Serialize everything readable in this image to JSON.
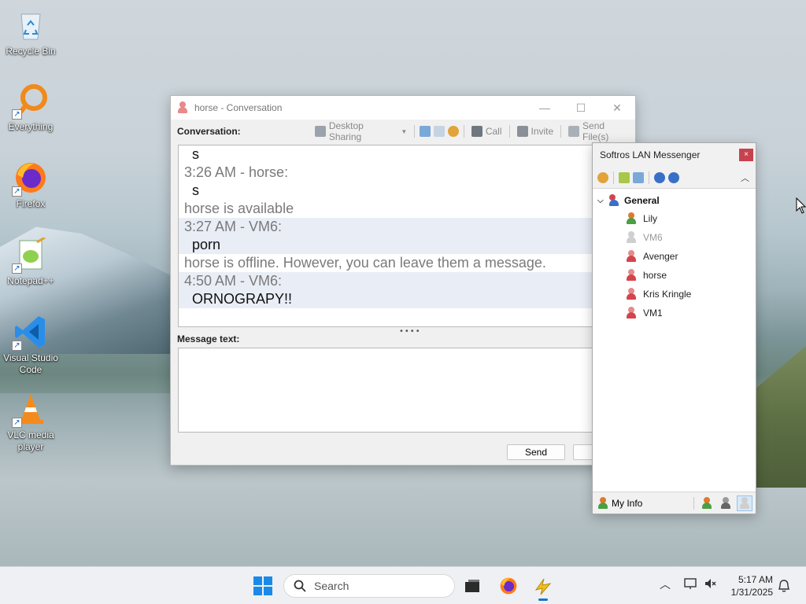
{
  "desktop": {
    "icons": [
      {
        "label": "Recycle Bin"
      },
      {
        "label": "Everything"
      },
      {
        "label": "Firefox"
      },
      {
        "label": "Notepad++"
      },
      {
        "label": "Visual Studio Code"
      },
      {
        "label": "VLC media player"
      }
    ]
  },
  "conversation_window": {
    "title": "horse - Conversation",
    "conversation_label": "Conversation:",
    "toolbar": {
      "desktop_sharing": "Desktop Sharing",
      "call": "Call",
      "invite": "Invite",
      "send_files": "Send File(s)"
    },
    "messages": [
      {
        "text": "s",
        "kind": "body",
        "hl": false
      },
      {
        "text": "3:26 AM - horse:",
        "kind": "meta",
        "hl": false
      },
      {
        "text": "s",
        "kind": "body",
        "hl": false
      },
      {
        "text": "horse is available",
        "kind": "meta",
        "hl": false
      },
      {
        "text": "3:27 AM - VM6:",
        "kind": "meta",
        "hl": true
      },
      {
        "text": "porn",
        "kind": "body",
        "hl": true
      },
      {
        "text": "horse is offline. However, you can leave them a message.",
        "kind": "meta",
        "hl": false
      },
      {
        "text": "4:50 AM - VM6:",
        "kind": "meta",
        "hl": true
      },
      {
        "text": "ORNOGRAPY!!",
        "kind": "body",
        "hl": true
      }
    ],
    "message_label": "Message text:",
    "message_value": "",
    "send_label": "Send"
  },
  "messenger_window": {
    "title": "Softros LAN Messenger",
    "close_icon": "×",
    "group": {
      "name": "General"
    },
    "users": [
      {
        "name": "Lily",
        "status": "available"
      },
      {
        "name": "VM6",
        "status": "offline"
      },
      {
        "name": "Avenger",
        "status": "red"
      },
      {
        "name": "horse",
        "status": "red"
      },
      {
        "name": "Kris Kringle",
        "status": "red"
      },
      {
        "name": "VM1",
        "status": "red"
      }
    ],
    "my_info_label": "My Info"
  },
  "taskbar": {
    "search_placeholder": "Search",
    "time": "5:17 AM",
    "date": "1/31/2025"
  },
  "colors": {
    "available": "#e07a2a",
    "offline": "#bbbbbb",
    "red": "#d4444c",
    "accent": "#1a73c8"
  }
}
